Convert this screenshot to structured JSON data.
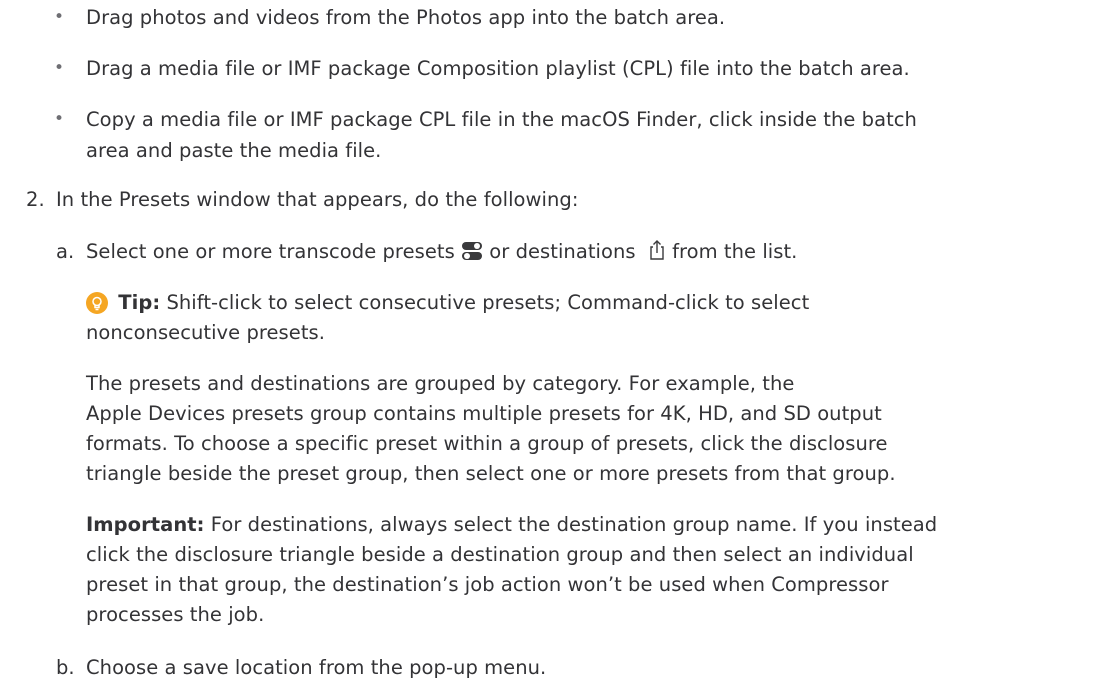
{
  "bullets": [
    {
      "lines": [
        "Drag photos and videos from the Photos app into the batch area."
      ]
    },
    {
      "lines": [
        "Drag a media file or IMF package Composition playlist (CPL) file into the batch area."
      ]
    },
    {
      "lines": [
        "Copy a media file or IMF package CPL file in the macOS Finder, click inside the batch",
        "area and paste the media file."
      ]
    }
  ],
  "step2": {
    "marker": "2.",
    "text": "In the Presets window that appears, do the following:"
  },
  "step_a": {
    "marker": "a.",
    "text_before": "Select one or more transcode presets",
    "text_middle": "or destinations",
    "text_after": "from the list.",
    "preset_icon": "toggle-switches-icon",
    "destination_icon": "share-icon"
  },
  "tip": {
    "icon": "lightbulb-icon",
    "label": "Tip:",
    "line1": "Shift-click to select consecutive presets; Command-click to select",
    "line2": "nonconsecutive presets."
  },
  "para_grouping": {
    "lines": [
      "The presets and destinations are grouped by category. For example, the",
      "Apple Devices presets group contains multiple presets for 4K, HD, and SD output",
      "formats. To choose a specific preset within a group of presets, click the disclosure",
      "triangle beside the preset group, then select one or more presets from that group."
    ]
  },
  "important": {
    "label": "Important:",
    "line1": "For destinations, always select the destination group name. If you instead",
    "lines": [
      "click the disclosure triangle beside a destination group and then select an individual",
      "preset in that group, the destination’s job action won’t be used when Compressor",
      "processes the job."
    ]
  },
  "step_b": {
    "marker": "b.",
    "text": "Choose a save location from the pop-up menu."
  },
  "colors": {
    "text": "#333336",
    "tip_icon": "#f5a623"
  }
}
